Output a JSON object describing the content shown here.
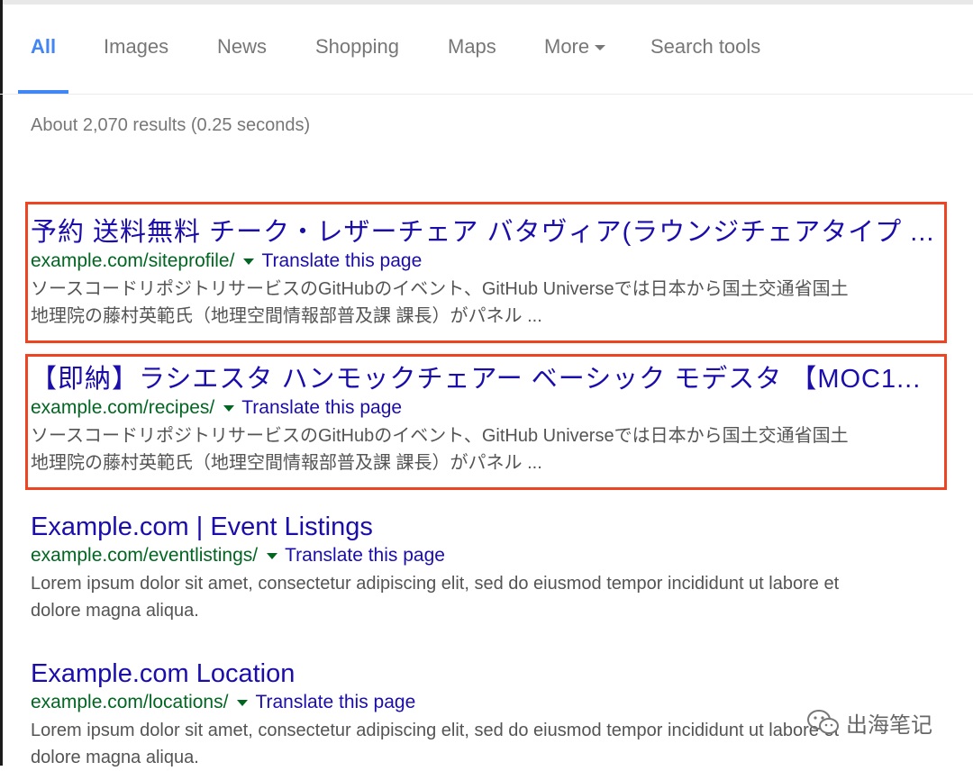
{
  "tabs": [
    {
      "label": "All",
      "active": true
    },
    {
      "label": "Images"
    },
    {
      "label": "News"
    },
    {
      "label": "Shopping"
    },
    {
      "label": "Maps"
    },
    {
      "label": "More"
    },
    {
      "label": "Search tools"
    }
  ],
  "stats": "About 2,070 results (0.25 seconds)",
  "results": [
    {
      "title": "予約 送料無料 チーク・レザーチェア バタヴィア(ラウンジチェアタイプ ...",
      "url": "example.com/siteprofile/",
      "translate": "Translate this page",
      "snippet_line1": "ソースコードリポジトリサービスのGitHubのイベント、GitHub Universeでは日本から国土交通省国土",
      "snippet_line2": "地理院の藤村英範氏（地理空間情報部普及課 課長）がパネル ...",
      "highlighted": true
    },
    {
      "title": "【即納】ラシエスタ ハンモックチェアー ベーシック モデスタ 【MOC1...",
      "url": "example.com/recipes/",
      "translate": "Translate this page",
      "snippet_line1": "ソースコードリポジトリサービスのGitHubのイベント、GitHub Universeでは日本から国土交通省国土",
      "snippet_line2": "地理院の藤村英範氏（地理空間情報部普及課 課長）がパネル ...",
      "highlighted": true
    },
    {
      "title": "Example.com | Event Listings",
      "url": "example.com/eventlistings/",
      "translate": "Translate this page",
      "snippet_line1": "Lorem ipsum dolor sit amet, consectetur adipiscing elit, sed do eiusmod tempor incididunt ut labore et",
      "snippet_line2": "dolore magna aliqua."
    },
    {
      "title": "Example.com Location",
      "url": "example.com/locations/",
      "translate": "Translate this page",
      "snippet_line1": "Lorem ipsum dolor sit amet, consectetur adipiscing elit, sed do eiusmod tempor incididunt ut labore et",
      "snippet_line2": "dolore magna aliqua."
    }
  ],
  "watermark": "出海笔记",
  "colors": {
    "accent": "#4285f4",
    "link": "#1a0dab",
    "url": "#006621",
    "highlight_box": "#ee4422"
  }
}
